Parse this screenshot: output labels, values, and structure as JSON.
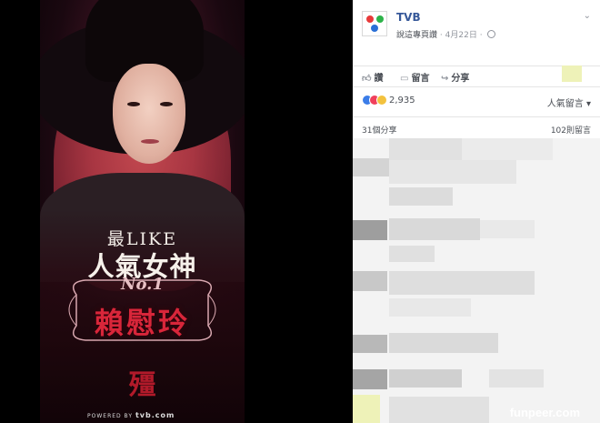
{
  "poster": {
    "line1": "最LIKE",
    "line2": "人氣女神",
    "rank": "No.1",
    "name": "賴慰玲",
    "show_logo": "殭",
    "powered_prefix": "POWERED BY",
    "powered_brand": "tvb.com"
  },
  "post": {
    "page_name": "TVB",
    "author": "說這專頁讚",
    "date": "4月22日",
    "separator": "·",
    "chevron_icon": "chevron-down-icon",
    "actions": [
      {
        "label": "讚",
        "icon": "thumbs-up-icon"
      },
      {
        "label": "留言",
        "icon": "comment-icon"
      },
      {
        "label": "分享",
        "icon": "share-icon"
      }
    ],
    "reaction_count": "2,935",
    "sort_label": "人氣留言",
    "shares": "31個分享",
    "comments": "102則留言"
  },
  "colors": {
    "facebook_link": "#365899",
    "poster_name": "#d8263a"
  },
  "watermark": "funpeer.com"
}
